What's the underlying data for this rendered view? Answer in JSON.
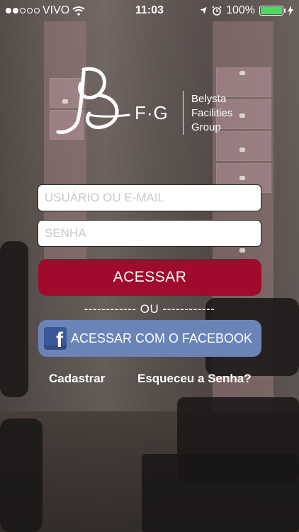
{
  "status_bar": {
    "carrier": "VIVO",
    "time": "11:03",
    "battery": "100%",
    "icons": [
      "signal-dots",
      "wifi-icon",
      "location-arrow-icon",
      "alarm-icon",
      "battery-icon",
      "charging-bolt-icon"
    ]
  },
  "logo": {
    "monogram": "F·G",
    "brand_lines": [
      "Belysta",
      "Facilities",
      "Group"
    ]
  },
  "form": {
    "user_placeholder": "USUÁRIO OU E-MAIL",
    "user_value": "",
    "password_placeholder": "SENHA",
    "password_value": ""
  },
  "buttons": {
    "login": "ACESSAR",
    "divider": "------------ OU ------------",
    "facebook": "ACESSAR COM O FACEBOOK",
    "signup": "Cadastrar",
    "forgot": "Esqueceu a Senha?"
  },
  "colors": {
    "login_button": "#a00a2c",
    "facebook_button": "#6b84b8",
    "battery_fill": "#4cd964"
  }
}
